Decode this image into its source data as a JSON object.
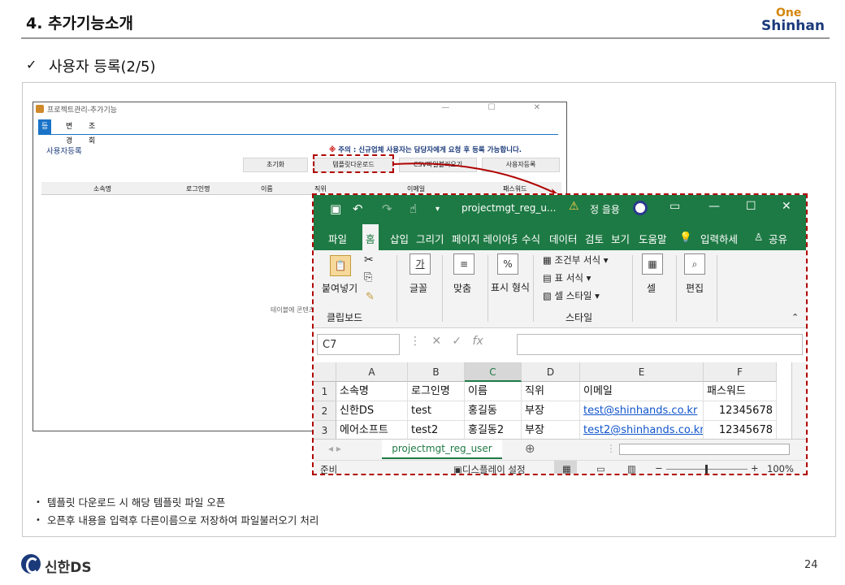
{
  "slide": {
    "title": "4. 추가기능소개",
    "subtitle_check": "✓",
    "subtitle": "사용자 등록(2/5)",
    "logo_top": "One",
    "logo_bottom": "Shinhan"
  },
  "app": {
    "window_title": "프로젝트관리-추가기능",
    "window_buttons": "—  ☐  ✕",
    "tabs": [
      "등록",
      "변경",
      "조회"
    ],
    "section_title": "사용자등록",
    "notice_mark": "※",
    "notice": "주의 : 신규업체 사용자는 담당자에게 요청 후 등록 가능합니다.",
    "buttons": {
      "reset": "초기화",
      "template_download": "템플릿다운로드",
      "csv_load": "CSV파일불러오기",
      "register": "사용자등록"
    },
    "grid_columns": [
      "소속명",
      "로그인명",
      "이름",
      "직위",
      "이메일",
      "패스워드"
    ],
    "empty_message": "테이블에 콘텐츠"
  },
  "excel": {
    "filename": "projectmgt_reg_u...",
    "user": "정 을용",
    "menu_tabs": [
      "파일",
      "홈",
      "삽입",
      "그리기",
      "페이지 레이아웃",
      "수식",
      "데이터",
      "검토",
      "보기",
      "도움말"
    ],
    "tell_me": "입력하세",
    "share": "공유",
    "ribbon": {
      "paste": "붙여넣기",
      "clipboard": "클립보드",
      "font": "글꼴",
      "font_icon": "가",
      "align": "맞춤",
      "number": "표시 형식",
      "number_icon": "%",
      "conditional": "조건부 서식",
      "table_format": "표 서식",
      "cell_style": "셀 스타일",
      "style_group": "스타일",
      "cells": "셀",
      "editing": "편집"
    },
    "name_box": "C7",
    "fx": "fx",
    "columns": [
      "A",
      "B",
      "C",
      "D",
      "E",
      "F"
    ],
    "selected_column": "C",
    "rows": [
      {
        "num": "1",
        "cells": [
          "소속명",
          "로그인명",
          "이름",
          "직위",
          "이메일",
          "패스워드"
        ]
      },
      {
        "num": "2",
        "cells": [
          "신한DS",
          "test",
          "홍길동",
          "부장",
          "test@shinhands.co.kr",
          "12345678"
        ]
      },
      {
        "num": "3",
        "cells": [
          "에어소프트",
          "test2",
          "홍길동2",
          "부장",
          "test2@shinhands.co.kr",
          "12345678"
        ]
      }
    ],
    "sheet_tab": "projectmgt_reg_user",
    "status_ready": "준비",
    "status_display": "디스플레이 설정",
    "zoom": "100%"
  },
  "bullets": [
    "템플릿 다운로드 시 해당 템플릿 파일 오픈",
    "오픈후 내용을 입력후 다른이름으로 저장하여 파일불러오기 처리"
  ],
  "footer": {
    "brand": "신한DS",
    "page": "24"
  },
  "colors": {
    "excel_green": "#1e7a44",
    "highlight_red": "#b00000",
    "app_blue": "#1a73c7",
    "brand_navy": "#1b3a7a",
    "brand_orange": "#d4860f"
  }
}
